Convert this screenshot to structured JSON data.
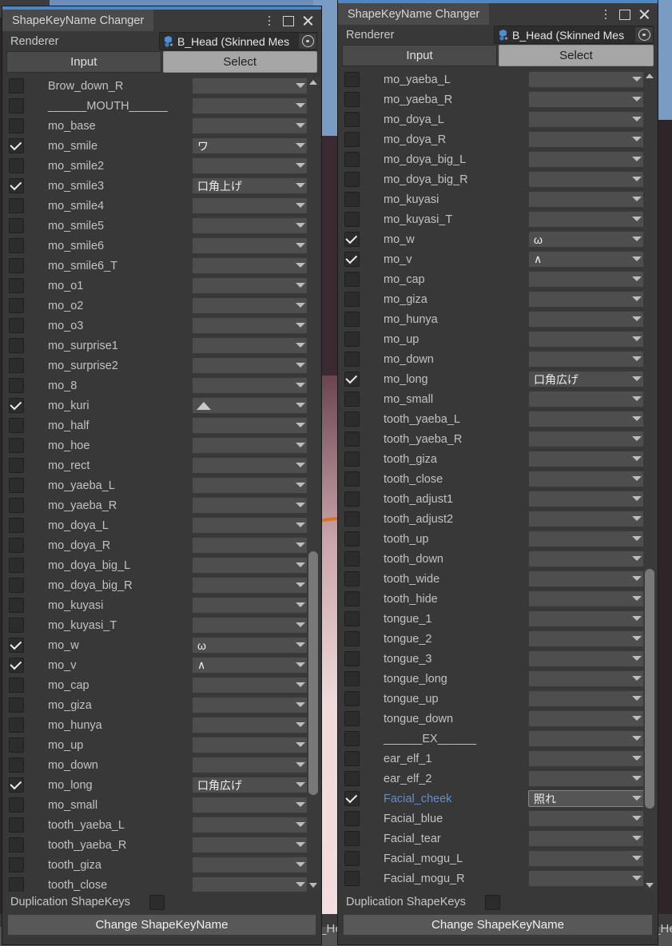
{
  "background": {
    "ghost_text_left": "_He",
    "ghost_text_right": "_He"
  },
  "windows": [
    {
      "id": "left",
      "title": "ShapeKeyName Changer",
      "controls": {
        "menu": "kebab-menu",
        "maximize": "maximize",
        "close": "close"
      },
      "renderer": {
        "label": "Renderer",
        "value": "B_Head (Skinned Mes",
        "icon": "skinned-mesh-renderer-icon",
        "picker": "object-picker"
      },
      "tabs": [
        {
          "label": "Input",
          "selected": false
        },
        {
          "label": "Select",
          "selected": true
        }
      ],
      "rows": [
        {
          "name": "Brow_down_R",
          "checked": false,
          "value": ""
        },
        {
          "name": "______MOUTH______",
          "checked": false,
          "value": ""
        },
        {
          "name": "mo_base",
          "checked": false,
          "value": ""
        },
        {
          "name": "mo_smile",
          "checked": true,
          "value": "ワ"
        },
        {
          "name": "mo_smile2",
          "checked": false,
          "value": ""
        },
        {
          "name": "mo_smile3",
          "checked": true,
          "value": "口角上げ"
        },
        {
          "name": "mo_smile4",
          "checked": false,
          "value": ""
        },
        {
          "name": "mo_smile5",
          "checked": false,
          "value": ""
        },
        {
          "name": "mo_smile6",
          "checked": false,
          "value": ""
        },
        {
          "name": "mo_smile6_T",
          "checked": false,
          "value": ""
        },
        {
          "name": "mo_o1",
          "checked": false,
          "value": ""
        },
        {
          "name": "mo_o2",
          "checked": false,
          "value": ""
        },
        {
          "name": "mo_o3",
          "checked": false,
          "value": ""
        },
        {
          "name": "mo_surprise1",
          "checked": false,
          "value": ""
        },
        {
          "name": "mo_surprise2",
          "checked": false,
          "value": ""
        },
        {
          "name": "mo_8",
          "checked": false,
          "value": ""
        },
        {
          "name": "mo_kuri",
          "checked": true,
          "value": "▲",
          "value_is_triangle": true
        },
        {
          "name": "mo_half",
          "checked": false,
          "value": ""
        },
        {
          "name": "mo_hoe",
          "checked": false,
          "value": ""
        },
        {
          "name": "mo_rect",
          "checked": false,
          "value": ""
        },
        {
          "name": "mo_yaeba_L",
          "checked": false,
          "value": ""
        },
        {
          "name": "mo_yaeba_R",
          "checked": false,
          "value": ""
        },
        {
          "name": "mo_doya_L",
          "checked": false,
          "value": ""
        },
        {
          "name": "mo_doya_R",
          "checked": false,
          "value": ""
        },
        {
          "name": "mo_doya_big_L",
          "checked": false,
          "value": ""
        },
        {
          "name": "mo_doya_big_R",
          "checked": false,
          "value": ""
        },
        {
          "name": "mo_kuyasi",
          "checked": false,
          "value": ""
        },
        {
          "name": "mo_kuyasi_T",
          "checked": false,
          "value": ""
        },
        {
          "name": "mo_w",
          "checked": true,
          "value": "ω"
        },
        {
          "name": "mo_v",
          "checked": true,
          "value": "∧"
        },
        {
          "name": "mo_cap",
          "checked": false,
          "value": ""
        },
        {
          "name": "mo_giza",
          "checked": false,
          "value": ""
        },
        {
          "name": "mo_hunya",
          "checked": false,
          "value": ""
        },
        {
          "name": "mo_up",
          "checked": false,
          "value": ""
        },
        {
          "name": "mo_down",
          "checked": false,
          "value": ""
        },
        {
          "name": "mo_long",
          "checked": true,
          "value": "口角広げ"
        },
        {
          "name": "mo_small",
          "checked": false,
          "value": ""
        },
        {
          "name": "tooth_yaeba_L",
          "checked": false,
          "value": ""
        },
        {
          "name": "tooth_yaeba_R",
          "checked": false,
          "value": ""
        },
        {
          "name": "tooth_giza",
          "checked": false,
          "value": ""
        },
        {
          "name": "tooth_close",
          "checked": false,
          "value": ""
        }
      ],
      "footer": {
        "duplication_label": "Duplication ShapeKeys",
        "duplication_checked": false,
        "button_label": "Change ShapeKeyName"
      }
    },
    {
      "id": "right",
      "title": "ShapeKeyName Changer",
      "controls": {
        "menu": "kebab-menu",
        "maximize": "maximize",
        "close": "close"
      },
      "renderer": {
        "label": "Renderer",
        "value": "B_Head (Skinned Mes",
        "icon": "skinned-mesh-renderer-icon",
        "picker": "object-picker"
      },
      "tabs": [
        {
          "label": "Input",
          "selected": false
        },
        {
          "label": "Select",
          "selected": true
        }
      ],
      "rows": [
        {
          "name": "mo_yaeba_L",
          "checked": false,
          "value": ""
        },
        {
          "name": "mo_yaeba_R",
          "checked": false,
          "value": ""
        },
        {
          "name": "mo_doya_L",
          "checked": false,
          "value": ""
        },
        {
          "name": "mo_doya_R",
          "checked": false,
          "value": ""
        },
        {
          "name": "mo_doya_big_L",
          "checked": false,
          "value": ""
        },
        {
          "name": "mo_doya_big_R",
          "checked": false,
          "value": ""
        },
        {
          "name": "mo_kuyasi",
          "checked": false,
          "value": ""
        },
        {
          "name": "mo_kuyasi_T",
          "checked": false,
          "value": ""
        },
        {
          "name": "mo_w",
          "checked": true,
          "value": "ω"
        },
        {
          "name": "mo_v",
          "checked": true,
          "value": "∧"
        },
        {
          "name": "mo_cap",
          "checked": false,
          "value": ""
        },
        {
          "name": "mo_giza",
          "checked": false,
          "value": ""
        },
        {
          "name": "mo_hunya",
          "checked": false,
          "value": ""
        },
        {
          "name": "mo_up",
          "checked": false,
          "value": ""
        },
        {
          "name": "mo_down",
          "checked": false,
          "value": ""
        },
        {
          "name": "mo_long",
          "checked": true,
          "value": "口角広げ"
        },
        {
          "name": "mo_small",
          "checked": false,
          "value": ""
        },
        {
          "name": "tooth_yaeba_L",
          "checked": false,
          "value": ""
        },
        {
          "name": "tooth_yaeba_R",
          "checked": false,
          "value": ""
        },
        {
          "name": "tooth_giza",
          "checked": false,
          "value": ""
        },
        {
          "name": "tooth_close",
          "checked": false,
          "value": ""
        },
        {
          "name": "tooth_adjust1",
          "checked": false,
          "value": ""
        },
        {
          "name": "tooth_adjust2",
          "checked": false,
          "value": ""
        },
        {
          "name": "tooth_up",
          "checked": false,
          "value": ""
        },
        {
          "name": "tooth_down",
          "checked": false,
          "value": ""
        },
        {
          "name": "tooth_wide",
          "checked": false,
          "value": ""
        },
        {
          "name": "tooth_hide",
          "checked": false,
          "value": ""
        },
        {
          "name": "tongue_1",
          "checked": false,
          "value": ""
        },
        {
          "name": "tongue_2",
          "checked": false,
          "value": ""
        },
        {
          "name": "tongue_3",
          "checked": false,
          "value": ""
        },
        {
          "name": "tongue_long",
          "checked": false,
          "value": ""
        },
        {
          "name": "tongue_up",
          "checked": false,
          "value": ""
        },
        {
          "name": "tongue_down",
          "checked": false,
          "value": ""
        },
        {
          "name": "______EX______",
          "checked": false,
          "value": ""
        },
        {
          "name": "ear_elf_1",
          "checked": false,
          "value": ""
        },
        {
          "name": "ear_elf_2",
          "checked": false,
          "value": ""
        },
        {
          "name": "Facial_cheek",
          "checked": true,
          "value": "照れ",
          "highlighted": true,
          "focused": true
        },
        {
          "name": "Facial_blue",
          "checked": false,
          "value": ""
        },
        {
          "name": "Facial_tear",
          "checked": false,
          "value": ""
        },
        {
          "name": "Facial_mogu_L",
          "checked": false,
          "value": ""
        },
        {
          "name": "Facial_mogu_R",
          "checked": false,
          "value": ""
        }
      ],
      "footer": {
        "duplication_label": "Duplication ShapeKeys",
        "duplication_checked": false,
        "button_label": "Change ShapeKeyName"
      }
    }
  ],
  "colors": {
    "accent_blue": "#4e87c6",
    "highlight_text": "#5b8fd6",
    "panel_bg": "#383838",
    "selected_tab": "#a6a6a6"
  }
}
